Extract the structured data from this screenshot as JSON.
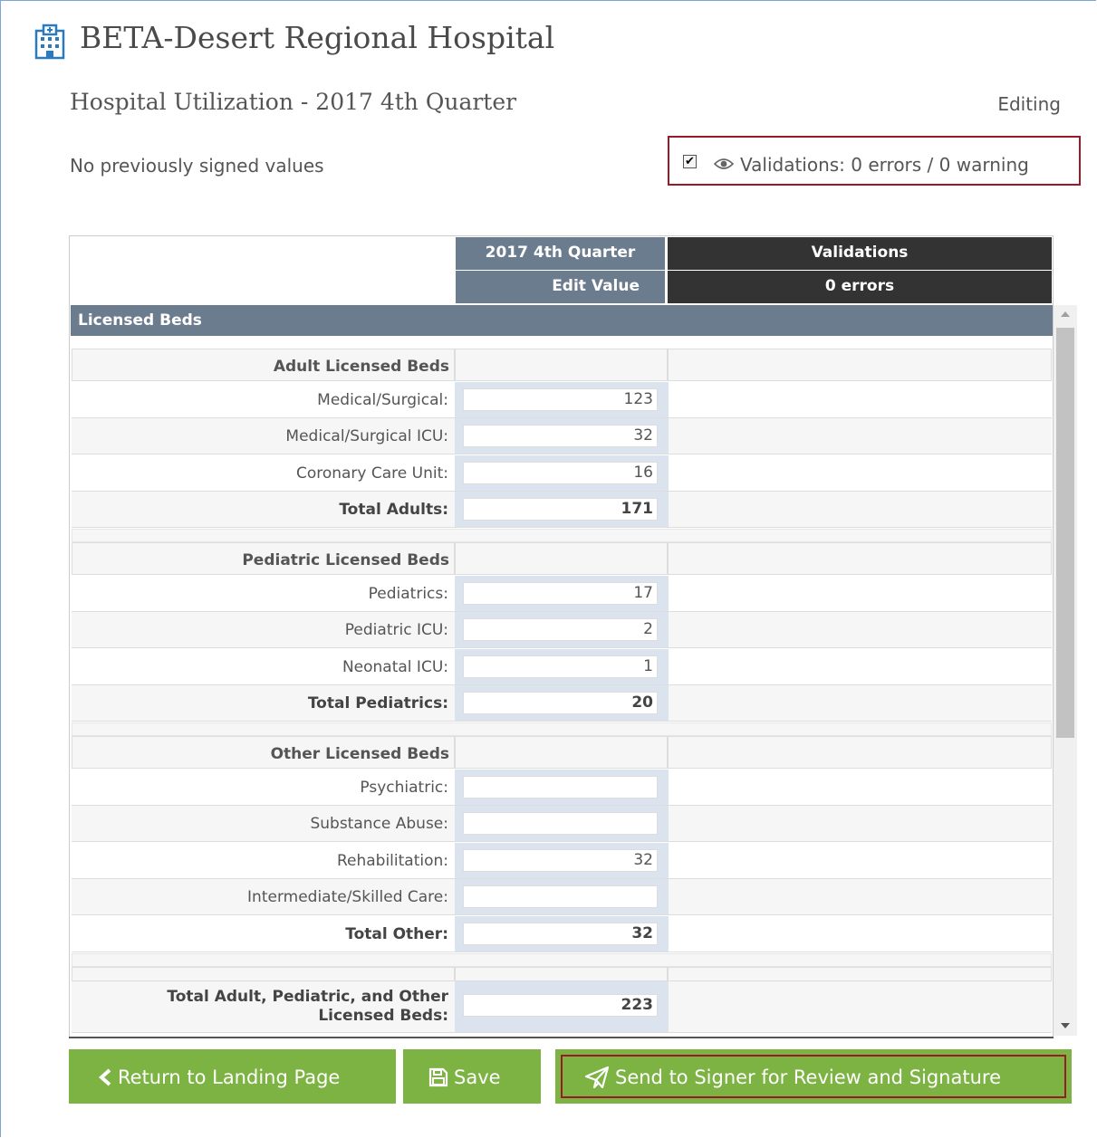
{
  "header": {
    "hospital_name": "BETA-Desert Regional Hospital",
    "report_title": "Hospital Utilization - 2017 4th Quarter",
    "status": "Editing",
    "previous_signed": "No previously signed values",
    "validations_label": "Validations: 0 errors / 0 warning",
    "validations_checked": true
  },
  "table": {
    "col_quarter": "2017 4th Quarter",
    "col_edit": "Edit Value",
    "col_validations": "Validations",
    "col_errors": "0 errors",
    "section": "Licensed Beds",
    "groups": [
      {
        "title": "Adult Licensed Beds",
        "rows": [
          {
            "label": "Medical/Surgical:",
            "value": "123"
          },
          {
            "label": "Medical/Surgical ICU:",
            "value": "32"
          },
          {
            "label": "Coronary Care Unit:",
            "value": "16"
          },
          {
            "label": "Total Adults:",
            "value": "171"
          }
        ]
      },
      {
        "title": "Pediatric Licensed Beds",
        "rows": [
          {
            "label": "Pediatrics:",
            "value": "17"
          },
          {
            "label": "Pediatric ICU:",
            "value": "2"
          },
          {
            "label": "Neonatal ICU:",
            "value": "1"
          },
          {
            "label": "Total Pediatrics:",
            "value": "20"
          }
        ]
      },
      {
        "title": "Other Licensed Beds",
        "rows": [
          {
            "label": "Psychiatric:",
            "value": ""
          },
          {
            "label": "Substance Abuse:",
            "value": ""
          },
          {
            "label": "Rehabilitation:",
            "value": "32"
          },
          {
            "label": "Intermediate/Skilled Care:",
            "value": ""
          },
          {
            "label": "Total Other:",
            "value": "32"
          }
        ]
      }
    ],
    "grand_total_label_1": "Total Adult, Pediatric, and Other",
    "grand_total_label_2": "Licensed Beds:",
    "grand_total_value": "223"
  },
  "buttons": {
    "return": "Return to Landing Page",
    "save": "Save",
    "send": "Send to Signer for Review and Signature"
  },
  "colors": {
    "header_blue": "#6c7c8f",
    "header_dark": "#333333",
    "button_green": "#7cb342",
    "highlight_red": "#9b1a2a"
  }
}
